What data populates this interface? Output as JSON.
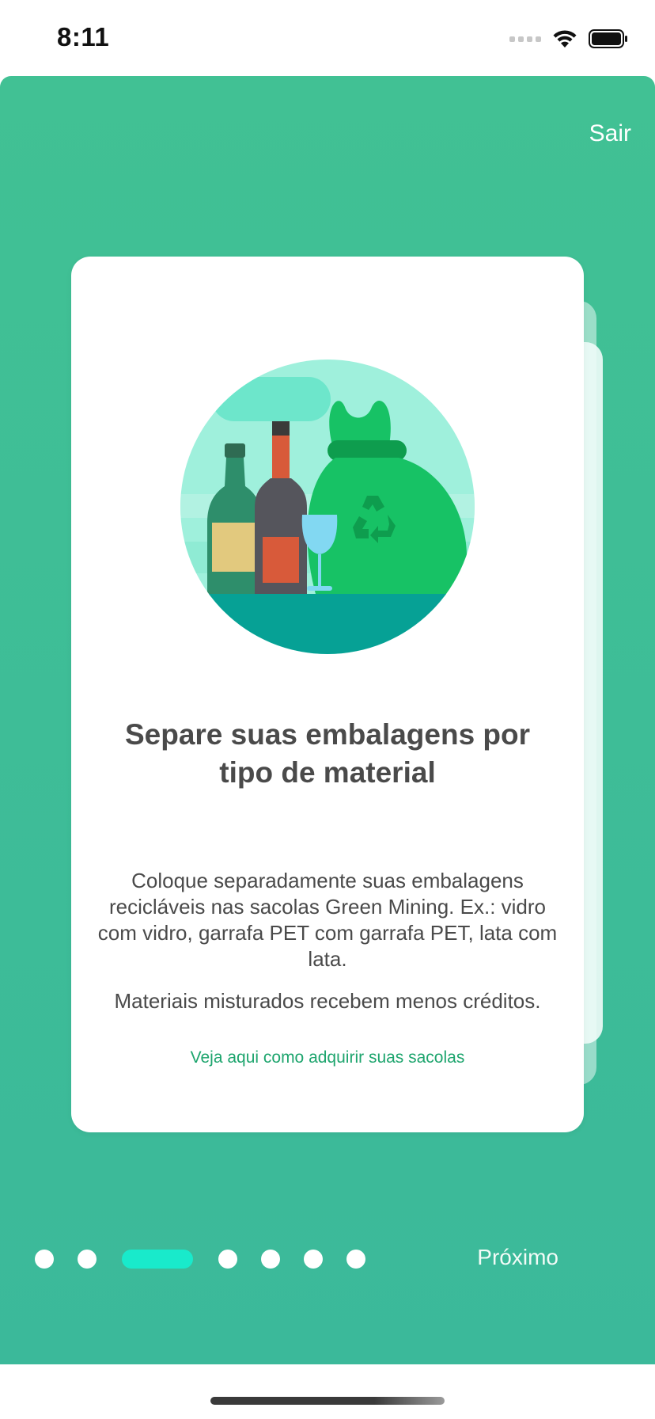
{
  "status_bar": {
    "time": "8:11"
  },
  "header": {
    "exit_label": "Sair"
  },
  "card": {
    "title": "Separe suas embalagens por tipo de material",
    "body_paragraph_1": "Coloque separadamente suas embalagens recicláveis nas sacolas Green Mining. Ex.: vidro com vidro, garrafa PET com garrafa PET, lata com lata.",
    "body_paragraph_2": "Materiais misturados recebem menos créditos.",
    "link_label": "Veja aqui como adquirir suas sacolas"
  },
  "pager": {
    "total_pages": 7,
    "current_page": 3,
    "next_label": "Próximo"
  },
  "colors": {
    "background_green": "#41c194",
    "active_dot": "#19eacb",
    "link_green": "#1ea56e",
    "text_dark": "#4a4a4a"
  },
  "icons": [
    "wifi-icon",
    "battery-icon",
    "cellular-signal-icon",
    "recycling-illustration"
  ]
}
